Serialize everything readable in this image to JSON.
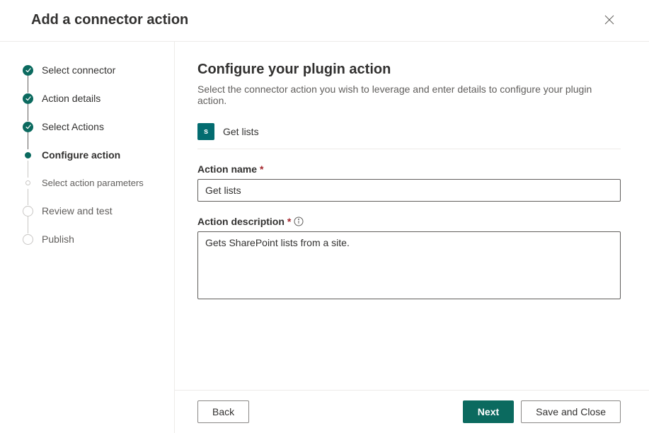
{
  "header": {
    "title": "Add a connector action"
  },
  "steps": [
    {
      "label": "Select connector",
      "state": "completed"
    },
    {
      "label": "Action details",
      "state": "completed"
    },
    {
      "label": "Select Actions",
      "state": "completed"
    },
    {
      "label": "Configure action",
      "state": "current"
    },
    {
      "label": "Select action parameters",
      "state": "sub"
    },
    {
      "label": "Review and test",
      "state": "pending"
    },
    {
      "label": "Publish",
      "state": "pending"
    }
  ],
  "main": {
    "heading": "Configure your plugin action",
    "subtitle": "Select the connector action you wish to leverage and enter details to configure your plugin action.",
    "connector": {
      "icon_text": "s",
      "name": "Get lists"
    },
    "fields": {
      "action_name": {
        "label": "Action name",
        "required_mark": "*",
        "value": "Get lists"
      },
      "action_description": {
        "label": "Action description",
        "required_mark": "*",
        "value": "Gets SharePoint lists from a site."
      }
    }
  },
  "footer": {
    "back": "Back",
    "next": "Next",
    "save_close": "Save and Close"
  }
}
